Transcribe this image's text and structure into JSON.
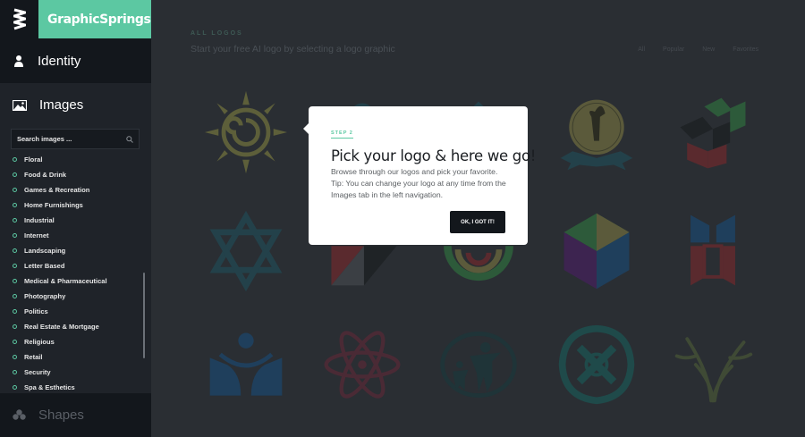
{
  "brand": {
    "name": "GraphicSprings",
    "mark_icon": "ws-monogram-icon"
  },
  "sidebar": {
    "identity": {
      "label": "Identity",
      "icon": "person-icon"
    },
    "images": {
      "label": "Images",
      "icon": "picture-icon"
    },
    "search": {
      "placeholder": "Search images ...",
      "icon": "search-icon"
    },
    "categories": [
      "Floral",
      "Food & Drink",
      "Games & Recreation",
      "Home Furnishings",
      "Industrial",
      "Internet",
      "Landscaping",
      "Letter Based",
      "Medical & Pharmaceutical",
      "Photography",
      "Politics",
      "Real Estate & Mortgage",
      "Religious",
      "Retail",
      "Security",
      "Spa & Esthetics"
    ],
    "shapes": {
      "label": "Shapes",
      "icon": "shapes-icon"
    }
  },
  "main": {
    "crumb": "ALL LOGOS",
    "subtitle": "Start your free AI logo by selecting a logo graphic",
    "filters": [
      "All",
      "Popular",
      "New",
      "Favorites"
    ]
  },
  "modal": {
    "step": "STEP 2",
    "title": "Pick your logo & here we go!",
    "body": "Browse through our logos and pick your favorite. Tip: You can change your logo at any time from the Images tab in the left navigation.",
    "button": "OK, I GOT IT!"
  },
  "colors": {
    "accent": "#5cc8a2",
    "sidebar": "#13171c",
    "overlay": "#282c31"
  }
}
